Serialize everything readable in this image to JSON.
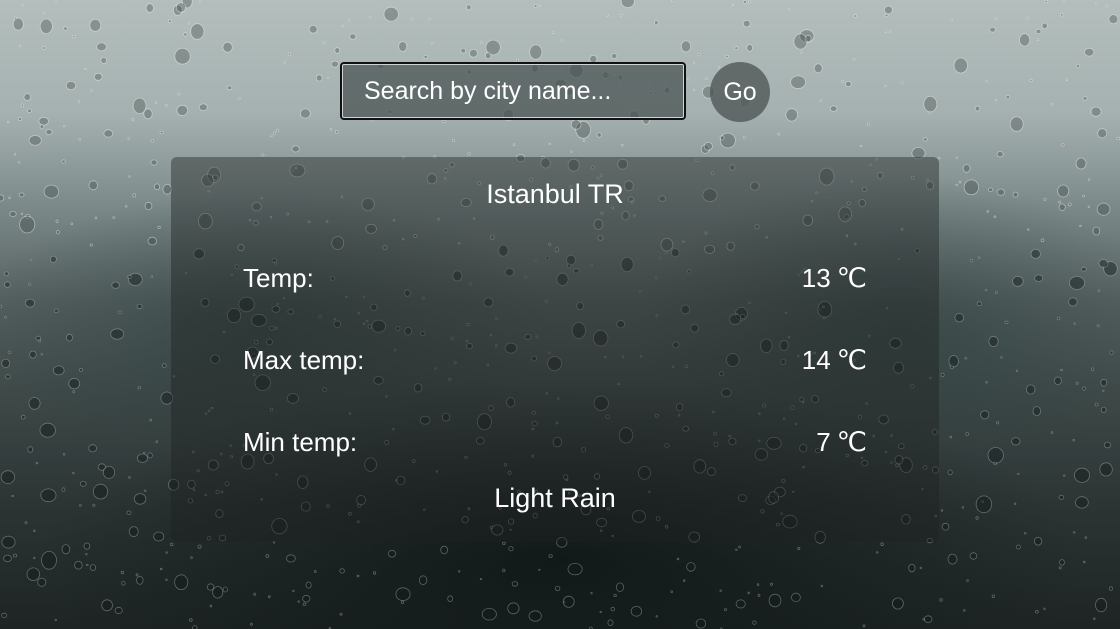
{
  "search": {
    "placeholder": "Search by city name...",
    "button_label": "Go"
  },
  "weather": {
    "city": "Istanbul TR",
    "temp_label": "Temp:",
    "temp_value": "13",
    "max_label": "Max temp:",
    "max_value": "14",
    "min_label": "Min temp:",
    "min_value": "7",
    "unit": "℃",
    "description": "Light Rain"
  },
  "colors": {
    "text": "#ffffff",
    "card_background": "rgba(30,34,34,0.42)"
  }
}
